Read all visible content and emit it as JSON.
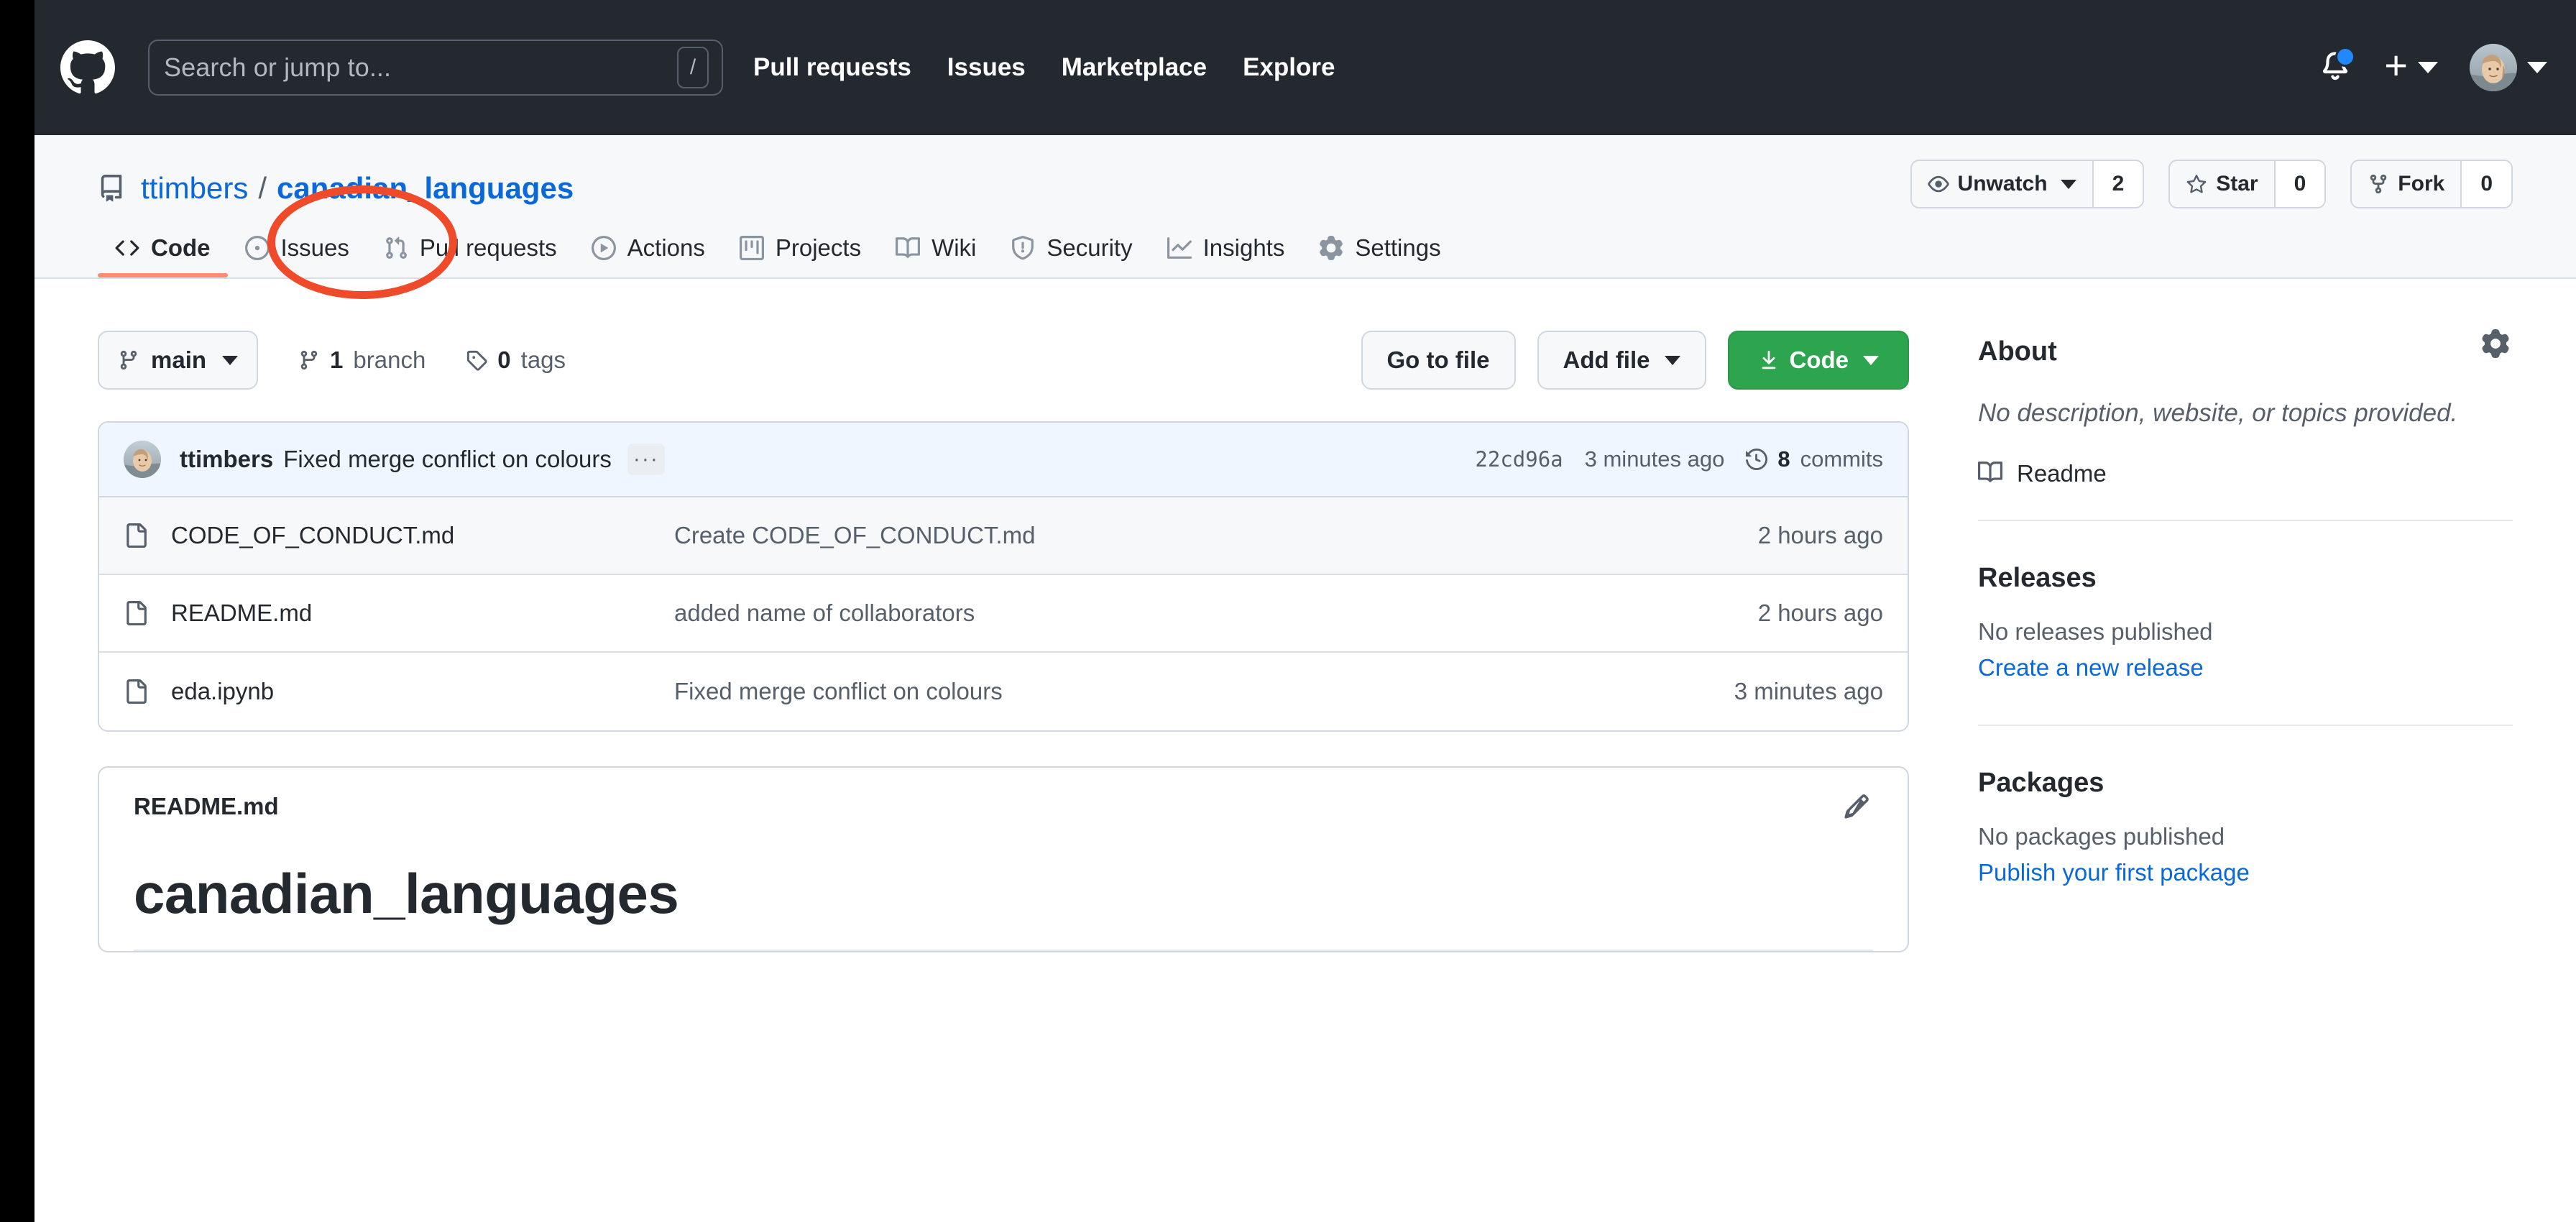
{
  "header": {
    "logo_icon": "github-mark-icon",
    "search": {
      "placeholder": "Search or jump to...",
      "value": "",
      "shortcut": "/"
    },
    "nav": [
      {
        "label": "Pull requests"
      },
      {
        "label": "Issues"
      },
      {
        "label": "Marketplace"
      },
      {
        "label": "Explore"
      }
    ],
    "notifications_icon": "bell-icon",
    "has_unread": true,
    "create_new_icon": "plus-icon",
    "account_icon": "avatar-icon"
  },
  "repo": {
    "icon": "repo-book-icon",
    "owner": "ttimbers",
    "separator": "/",
    "name": "canadian_languages",
    "actions": {
      "watch_label": "Unwatch",
      "watch_count": "2",
      "watch_icon": "eye-icon",
      "star_label": "Star",
      "star_count": "0",
      "star_icon": "star-icon",
      "fork_label": "Fork",
      "fork_count": "0",
      "fork_icon": "fork-icon"
    },
    "tabs": [
      {
        "label": "Code",
        "icon": "code-icon",
        "active": true,
        "annotated": false
      },
      {
        "label": "Issues",
        "icon": "issue-opened-icon",
        "active": false,
        "annotated": true
      },
      {
        "label": "Pull requests",
        "icon": "git-pull-request-icon",
        "active": false,
        "annotated": false
      },
      {
        "label": "Actions",
        "icon": "play-icon",
        "active": false,
        "annotated": false
      },
      {
        "label": "Projects",
        "icon": "project-icon",
        "active": false,
        "annotated": false
      },
      {
        "label": "Wiki",
        "icon": "book-icon",
        "active": false,
        "annotated": false
      },
      {
        "label": "Security",
        "icon": "shield-icon",
        "active": false,
        "annotated": false
      },
      {
        "label": "Insights",
        "icon": "graph-icon",
        "active": false,
        "annotated": false
      },
      {
        "label": "Settings",
        "icon": "gear-icon",
        "active": false,
        "annotated": false
      }
    ]
  },
  "annotation": {
    "shape": "ellipse",
    "color": "#ef4b2b",
    "target": "Issues"
  },
  "file_actions": {
    "branch_label": "main",
    "branch_icon": "git-branch-icon",
    "branches_count": "1",
    "branches_label": "branch",
    "tags_count": "0",
    "tags_label": "tags",
    "tag_icon": "tag-icon",
    "go_to_file_label": "Go to file",
    "add_file_label": "Add file",
    "code_label": "Code",
    "code_icon": "download-icon",
    "code_color": "#2da44e"
  },
  "latest_commit": {
    "author": "ttimbers",
    "message": "Fixed merge conflict on colours",
    "ellipsis": "···",
    "sha": "22cd96a",
    "time": "3 minutes ago",
    "commits_count": "8",
    "commits_label": "commits",
    "history_icon": "history-icon"
  },
  "files": [
    {
      "icon": "file-icon",
      "name": "CODE_OF_CONDUCT.md",
      "commit": "Create CODE_OF_CONDUCT.md",
      "time": "2 hours ago"
    },
    {
      "icon": "file-icon",
      "name": "README.md",
      "commit": "added name of collaborators",
      "time": "2 hours ago"
    },
    {
      "icon": "file-icon",
      "name": "eda.ipynb",
      "commit": "Fixed merge conflict on colours",
      "time": "3 minutes ago"
    }
  ],
  "readme": {
    "filename": "README.md",
    "edit_icon": "pencil-icon",
    "heading": "canadian_languages"
  },
  "sidebar": {
    "about": {
      "title": "About",
      "settings_icon": "gear-icon",
      "description": "No description, website, or topics provided.",
      "readme_link": "Readme",
      "readme_icon": "book-icon"
    },
    "releases": {
      "title": "Releases",
      "empty": "No releases published",
      "action": "Create a new release"
    },
    "packages": {
      "title": "Packages",
      "empty": "No packages published",
      "action": "Publish your first package"
    }
  }
}
